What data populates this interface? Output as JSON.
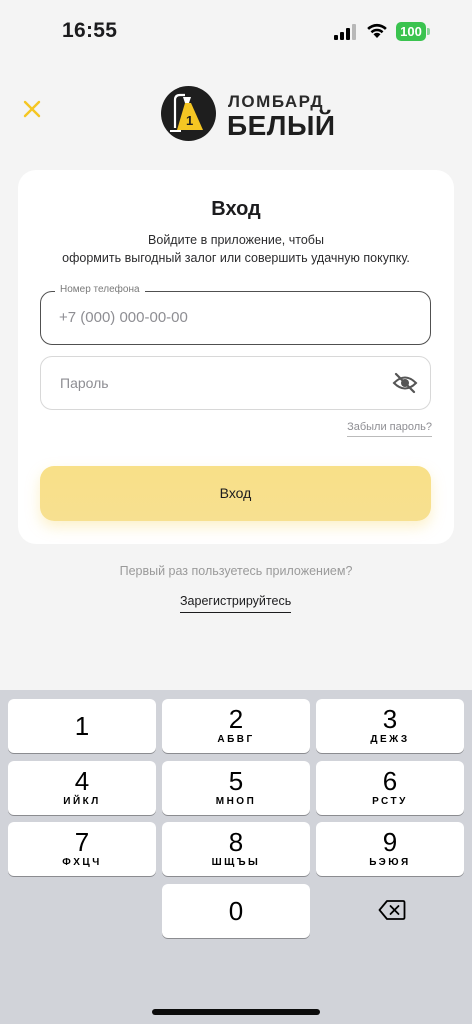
{
  "status_bar": {
    "time": "16:55",
    "battery": "100",
    "battery_color": "#3ac34f"
  },
  "header": {
    "close_icon": "close-icon",
    "logo_top": "ЛОМБАРД",
    "logo_bottom": "БЕЛЫЙ",
    "accent_color": "#f5c623"
  },
  "login": {
    "title": "Вход",
    "subtitle_line1": "Войдите в приложение, чтобы",
    "subtitle_line2": "оформить выгодный залог или совершить удачную покупку.",
    "phone_label": "Номер телефона",
    "phone_placeholder": "+7 (000) 000-00-00",
    "password_placeholder": "Пароль",
    "password_visibility_icon": "eye-off-icon",
    "forgot_password": "Забыли пароль?",
    "submit_label": "Вход",
    "submit_color": "#f8e088"
  },
  "footer": {
    "first_time_text": "Первый раз пользуетесь приложением?",
    "register_link": "Зарегистрируйтесь"
  },
  "keyboard": {
    "keys": [
      {
        "digit": "1",
        "letters": ""
      },
      {
        "digit": "2",
        "letters": "АБВГ"
      },
      {
        "digit": "3",
        "letters": "ДЕЖЗ"
      },
      {
        "digit": "4",
        "letters": "ИЙКЛ"
      },
      {
        "digit": "5",
        "letters": "МНОП"
      },
      {
        "digit": "6",
        "letters": "РСТУ"
      },
      {
        "digit": "7",
        "letters": "ФХЦЧ"
      },
      {
        "digit": "8",
        "letters": "ШЩЪЫ"
      },
      {
        "digit": "9",
        "letters": "ЬЭЮЯ"
      },
      {
        "digit": "0",
        "letters": ""
      }
    ],
    "delete_icon": "delete-icon"
  }
}
